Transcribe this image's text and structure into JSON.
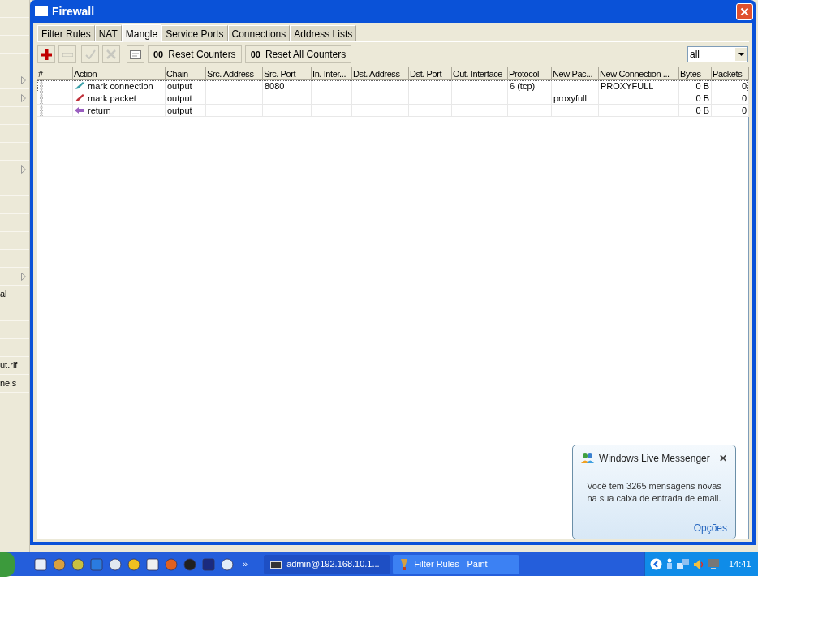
{
  "sidebar": {
    "items": [
      {
        "submenu": false
      },
      {
        "submenu": false
      },
      {
        "submenu": false
      },
      {
        "submenu": false
      },
      {
        "submenu": true
      },
      {
        "submenu": true
      },
      {
        "submenu": false
      },
      {
        "submenu": false
      },
      {
        "submenu": false
      },
      {
        "submenu": true
      },
      {
        "submenu": false
      },
      {
        "submenu": false
      },
      {
        "submenu": false
      },
      {
        "submenu": false
      },
      {
        "submenu": false
      },
      {
        "submenu": true
      },
      {
        "text": "al",
        "submenu": false
      },
      {
        "submenu": false
      },
      {
        "submenu": false
      },
      {
        "submenu": false
      },
      {
        "text": "ut.rif",
        "submenu": false
      },
      {
        "text": "nels",
        "submenu": false
      },
      {
        "submenu": false
      },
      {
        "submenu": false
      }
    ]
  },
  "window": {
    "title": "Firewall",
    "tabs": [
      {
        "label": "Filter Rules",
        "selected": false
      },
      {
        "label": "NAT",
        "selected": false
      },
      {
        "label": "Mangle",
        "selected": true
      },
      {
        "label": "Service Ports",
        "selected": false
      },
      {
        "label": "Connections",
        "selected": false
      },
      {
        "label": "Address Lists",
        "selected": false
      }
    ],
    "toolbar": {
      "buttons": [
        {
          "kind": "add",
          "disabled": false
        },
        {
          "kind": "remove",
          "disabled": true
        },
        {
          "kind": "enable",
          "disabled": true
        },
        {
          "kind": "disable",
          "disabled": true
        },
        {
          "kind": "comment",
          "disabled": false
        }
      ],
      "counter_buttons": [
        {
          "icon": "00",
          "label": "Reset Counters"
        },
        {
          "icon": "00",
          "label": "Reset All Counters"
        }
      ],
      "filter": {
        "value": "all"
      }
    },
    "table": {
      "columns": [
        "#",
        "",
        "Action",
        "Chain",
        "Src. Address",
        "Src. Port",
        "In. Inter...",
        "Dst. Address",
        "Dst. Port",
        "Out. Interface",
        "Protocol",
        "New Pac...",
        "New Connection ...",
        "Bytes",
        "Packets"
      ],
      "rows": [
        {
          "kind": "mark-connection",
          "selected": true,
          "cells": [
            "",
            "",
            "mark connection",
            "output",
            "",
            "8080",
            "",
            "",
            "",
            "",
            "6 (tcp)",
            "",
            "PROXYFULL",
            "0 B",
            "0"
          ]
        },
        {
          "kind": "mark-packet",
          "selected": false,
          "cells": [
            "",
            "",
            "mark packet",
            "output",
            "",
            "",
            "",
            "",
            "",
            "",
            "",
            "proxyfull",
            "",
            "0 B",
            "0"
          ]
        },
        {
          "kind": "return",
          "selected": false,
          "cells": [
            "",
            "",
            "return",
            "output",
            "",
            "",
            "",
            "",
            "",
            "",
            "",
            "",
            "",
            "0 B",
            "0"
          ]
        }
      ]
    }
  },
  "notification": {
    "title": "Windows Live Messenger",
    "close": "✕",
    "message": "Você tem 3265 mensagens novas na sua caixa de entrada de email.",
    "link": "Opções"
  },
  "taskbar": {
    "tasks": [
      {
        "label": "admin@192.168.10.1...",
        "selected": true,
        "kind": "terminal"
      },
      {
        "label": "Filter Rules - Paint",
        "selected": false,
        "kind": "paint"
      }
    ],
    "more": "»",
    "clock": "14:41"
  }
}
